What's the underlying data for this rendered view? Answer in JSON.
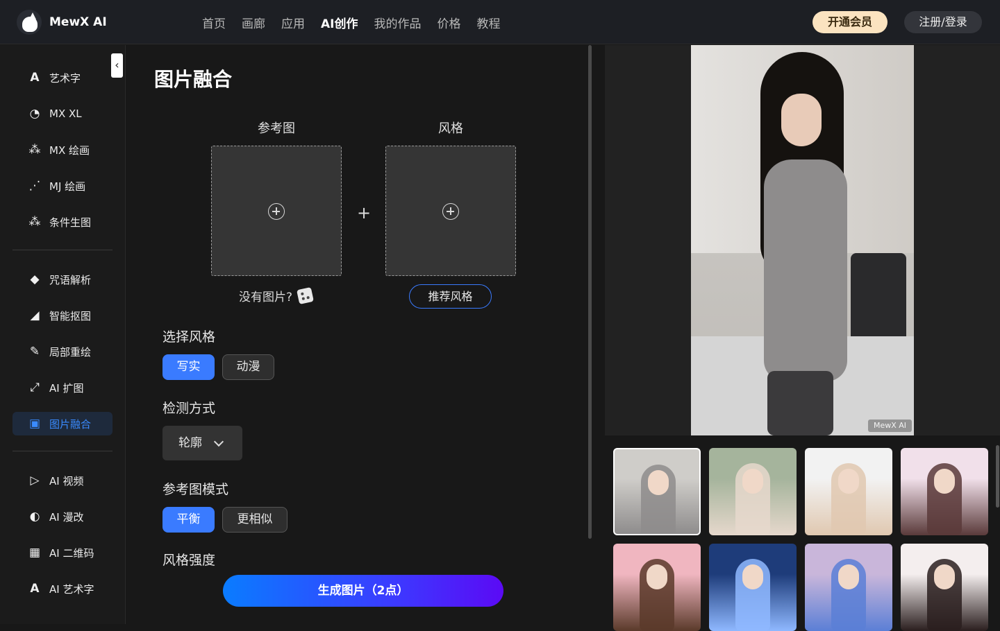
{
  "brand": {
    "name": "MewX AI"
  },
  "nav": {
    "items": [
      "首页",
      "画廊",
      "应用",
      "AI创作",
      "我的作品",
      "价格",
      "教程"
    ],
    "active_index": 3
  },
  "header": {
    "vip_label": "开通会员",
    "login_label": "注册/登录"
  },
  "sidebar": {
    "groups": [
      [
        {
          "icon": "letter-a-icon",
          "glyph": "A",
          "label": "艺术字"
        },
        {
          "icon": "palette-icon",
          "glyph": "◔",
          "label": "MX XL"
        },
        {
          "icon": "magic-wand-icon",
          "glyph": "⁂",
          "label": "MX 绘画"
        },
        {
          "icon": "sparkle-wand-icon",
          "glyph": "⋰",
          "label": "MJ 绘画"
        },
        {
          "icon": "nodes-icon",
          "glyph": "⁂",
          "label": "条件生图"
        }
      ],
      [
        {
          "icon": "tag-icon",
          "glyph": "◆",
          "label": "咒语解析"
        },
        {
          "icon": "eraser-icon",
          "glyph": "◢",
          "label": "智能抠图"
        },
        {
          "icon": "brush-icon",
          "glyph": "✎",
          "label": "局部重绘"
        },
        {
          "icon": "expand-image-icon",
          "glyph": "⤢",
          "label": "AI 扩图"
        },
        {
          "icon": "image-merge-icon",
          "glyph": "▣",
          "label": "图片融合",
          "active": true
        }
      ],
      [
        {
          "icon": "video-play-icon",
          "glyph": "▷",
          "label": "AI 视频"
        },
        {
          "icon": "half-circle-icon",
          "glyph": "◐",
          "label": "AI 漫改"
        },
        {
          "icon": "qrcode-icon",
          "glyph": "▦",
          "label": "AI 二维码"
        },
        {
          "icon": "letter-a-icon",
          "glyph": "A",
          "label": "AI 艺术字"
        }
      ]
    ]
  },
  "panel": {
    "title": "图片融合",
    "reference_label": "参考图",
    "style_label": "风格",
    "no_image_text": "没有图片?",
    "recommend_label": "推荐风格",
    "style_section": {
      "label": "选择风格",
      "options": [
        "写实",
        "动漫"
      ],
      "selected": 0
    },
    "detect_section": {
      "label": "检测方式",
      "value": "轮廓"
    },
    "mode_section": {
      "label": "参考图模式",
      "options": [
        "平衡",
        "更相似"
      ],
      "selected": 0
    },
    "strength_section": {
      "label": "风格强度"
    },
    "generate_label": "生成图片（2点）"
  },
  "preview": {
    "watermark": "MewX AI"
  },
  "thumbnails": [
    {
      "name": "thumb-office-woman",
      "colors": [
        "#cfcdc9",
        "#8e8c8c"
      ],
      "selected": true
    },
    {
      "name": "thumb-hanfu-girl",
      "colors": [
        "#a5b49c",
        "#e6d8cc"
      ]
    },
    {
      "name": "thumb-blonde-girl",
      "colors": [
        "#f2f2f2",
        "#e0c8b0"
      ]
    },
    {
      "name": "thumb-bunny-girl",
      "colors": [
        "#f1e0ea",
        "#5a3a3a"
      ]
    },
    {
      "name": "thumb-tulip-girl",
      "colors": [
        "#f0b6c0",
        "#5a3a2a"
      ]
    },
    {
      "name": "thumb-sword-warrior",
      "colors": [
        "#1e3c7a",
        "#8fb8ff"
      ]
    },
    {
      "name": "thumb-blue-hair-girl",
      "colors": [
        "#c9b6da",
        "#5b7fd6"
      ]
    },
    {
      "name": "thumb-twin-tail-girl",
      "colors": [
        "#f4eeee",
        "#2a1e1e"
      ]
    }
  ]
}
